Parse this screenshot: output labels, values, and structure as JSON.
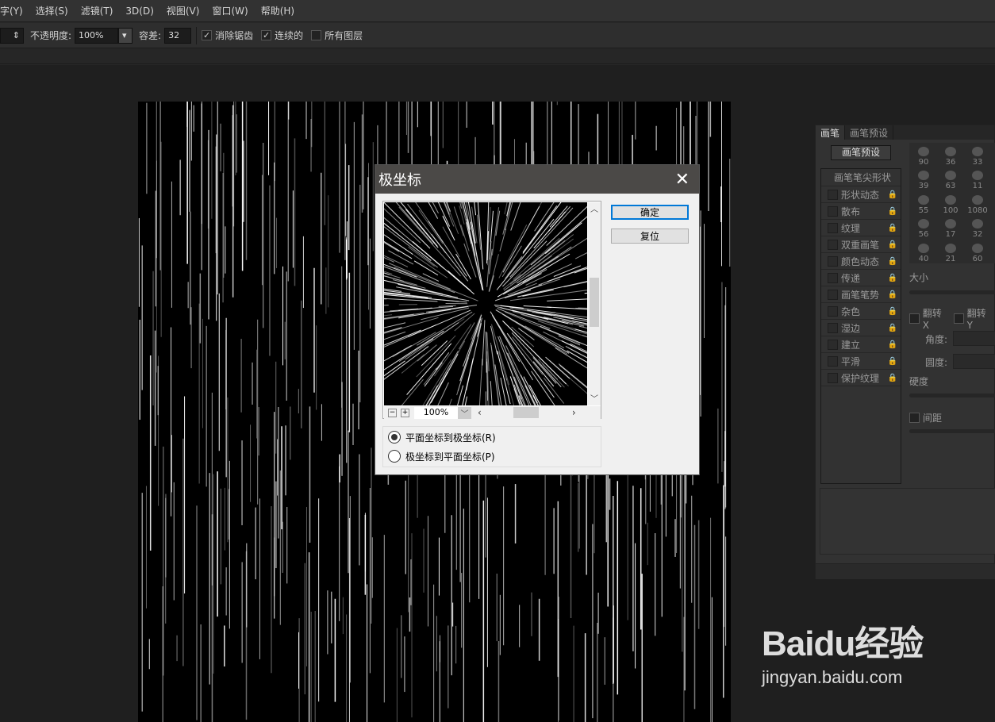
{
  "menu": [
    "字(Y)",
    "选择(S)",
    "滤镜(T)",
    "3D(D)",
    "视图(V)",
    "窗口(W)",
    "帮助(H)"
  ],
  "options": {
    "opacity_label": "不透明度:",
    "opacity_value": "100%",
    "tolerance_label": "容差:",
    "tolerance_value": "32",
    "antialias": "消除锯齿",
    "contiguous": "连续的",
    "all_layers": "所有图层"
  },
  "dialog": {
    "title": "极坐标",
    "ok": "确定",
    "reset": "复位",
    "zoom": "100%",
    "options": [
      {
        "label": "平面坐标到极坐标(R)",
        "selected": true
      },
      {
        "label": "极坐标到平面坐标(P)",
        "selected": false
      }
    ]
  },
  "panel": {
    "tabs": [
      "画笔",
      "画笔预设"
    ],
    "preset_button": "画笔预设",
    "tip_shape": "画笔笔尖形状",
    "items": [
      "形状动态",
      "散布",
      "纹理",
      "双重画笔",
      "颜色动态",
      "传递",
      "画笔笔势",
      "杂色",
      "湿边",
      "建立",
      "平滑",
      "保护纹理"
    ],
    "brush_sizes": [
      "90",
      "36",
      "33",
      "39",
      "63",
      "11",
      "55",
      "100",
      "1080",
      "56",
      "17",
      "32",
      "40",
      "21",
      "60"
    ],
    "size_label": "大小",
    "flip_x": "翻转 X",
    "flip_y": "翻转 Y",
    "angle_label": "角度:",
    "roundness_label": "圆度:",
    "hardness_label": "硬度",
    "spacing_label": "间距"
  },
  "watermark": {
    "brand": "Baidu经验",
    "url": "jingyan.baidu.com"
  }
}
